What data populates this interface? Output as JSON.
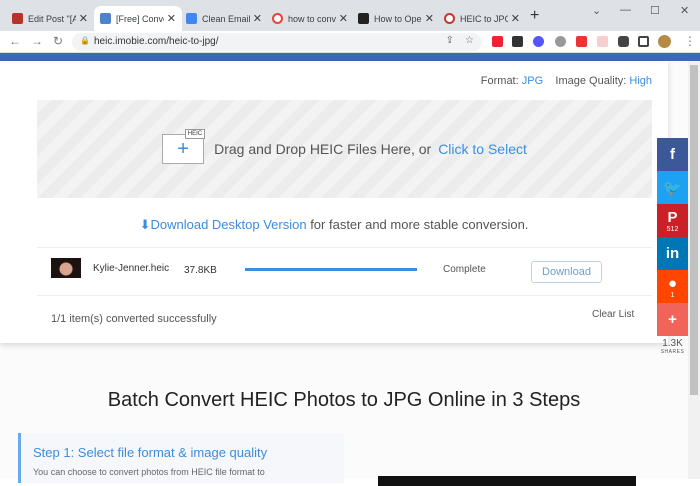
{
  "browser": {
    "tabs": [
      {
        "label": "Edit Post \"[A",
        "favicon_color": "#b5332a"
      },
      {
        "label": "[Free] Conve",
        "favicon_color": "#4f83c9",
        "active": true
      },
      {
        "label": "Clean Email:",
        "favicon_color": "#4285f4"
      },
      {
        "label": "how to conv",
        "favicon_color": "#ea4335"
      },
      {
        "label": "How to Ope",
        "favicon_color": "#222222"
      },
      {
        "label": "HEIC to JPG",
        "favicon_color": "#c0392b"
      }
    ],
    "url": "heic.imobie.com/heic-to-jpg/"
  },
  "options": {
    "format_label": "Format:",
    "format_value": "JPG",
    "quality_label": "Image Quality:",
    "quality_value": "High"
  },
  "dropzone": {
    "badge": "HEIC",
    "text": "Drag and Drop HEIC Files Here, or",
    "link": "Click to Select"
  },
  "desktop": {
    "link": "Download Desktop Version",
    "text": " for faster and more stable conversion."
  },
  "files": [
    {
      "name": "Kylie-Jenner.heic",
      "size": "37.8KB",
      "progress": 100,
      "status": "Complete",
      "action": "Download"
    }
  ],
  "summary": "1/1 item(s) converted successfully",
  "clear_label": "Clear List",
  "social": {
    "pinterest_count": "512",
    "reddit_count": "1",
    "total": "1.3K",
    "shares_label": "SHARES"
  },
  "heading": "Batch Convert HEIC Photos to JPG Online in 3 Steps",
  "step1": {
    "title": "Step 1: Select file format & image quality",
    "text": "You can choose to convert photos from HEIC file format to"
  }
}
